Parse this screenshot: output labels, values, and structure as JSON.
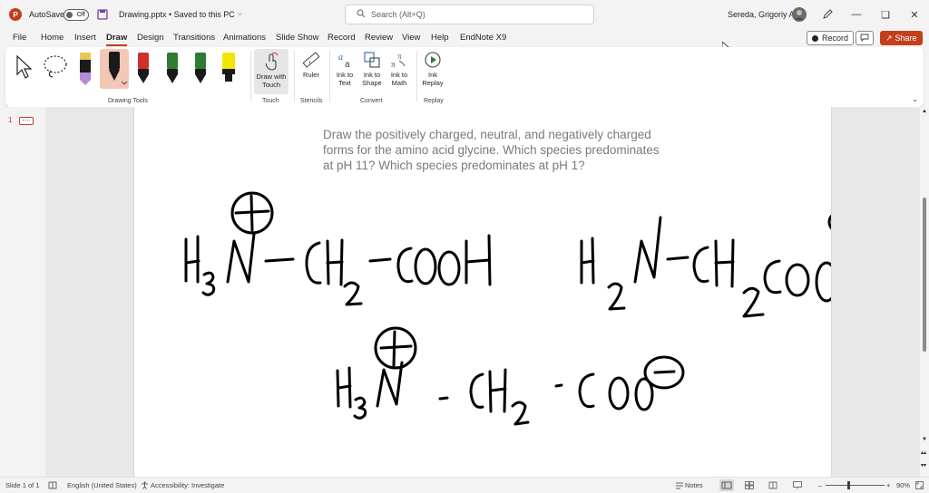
{
  "titlebar": {
    "autosave_label": "AutoSave",
    "autosave_state": "Off",
    "file_name": "Drawing.pptx • Saved to this PC",
    "search_placeholder": "Search (Alt+Q)",
    "user_name": "Sereda, Grigoriy A"
  },
  "menu": {
    "tabs": [
      "File",
      "Home",
      "Insert",
      "Draw",
      "Design",
      "Transitions",
      "Animations",
      "Slide Show",
      "Record",
      "Review",
      "View",
      "Help",
      "EndNote X9"
    ],
    "active_tab": "Draw",
    "record_label": "Record",
    "share_label": "Share"
  },
  "ribbon": {
    "groups": {
      "drawing_tools": "Drawing Tools",
      "touch": "Touch",
      "stencils": "Stencils",
      "convert": "Convert",
      "replay": "Replay"
    },
    "draw_with_touch": "Draw with Touch",
    "ruler": "Ruler",
    "ink_to_text": "Ink to Text",
    "ink_to_shape": "Ink to Shape",
    "ink_to_math": "Ink to Math",
    "ink_replay": "Ink Replay",
    "pen_colors": [
      "#1a1a1a",
      "#d32f2f",
      "#2e7d32",
      "#2e7d32",
      "#f2e600"
    ]
  },
  "thumbnails": {
    "slide_number": "1"
  },
  "slide": {
    "question": "Draw the positively charged, neutral, and negatively charged forms for the amino acid glycine. Which species predominates at pH 11? Which species predominates at pH 1?"
  },
  "status": {
    "slide_info": "Slide 1 of 1",
    "language": "English (United States)",
    "accessibility": "Accessibility: Investigate",
    "notes": "Notes",
    "zoom": "90%"
  },
  "colors": {
    "accent": "#c43e1c",
    "ink": "#000000",
    "question_text": "#7a7a7a"
  }
}
